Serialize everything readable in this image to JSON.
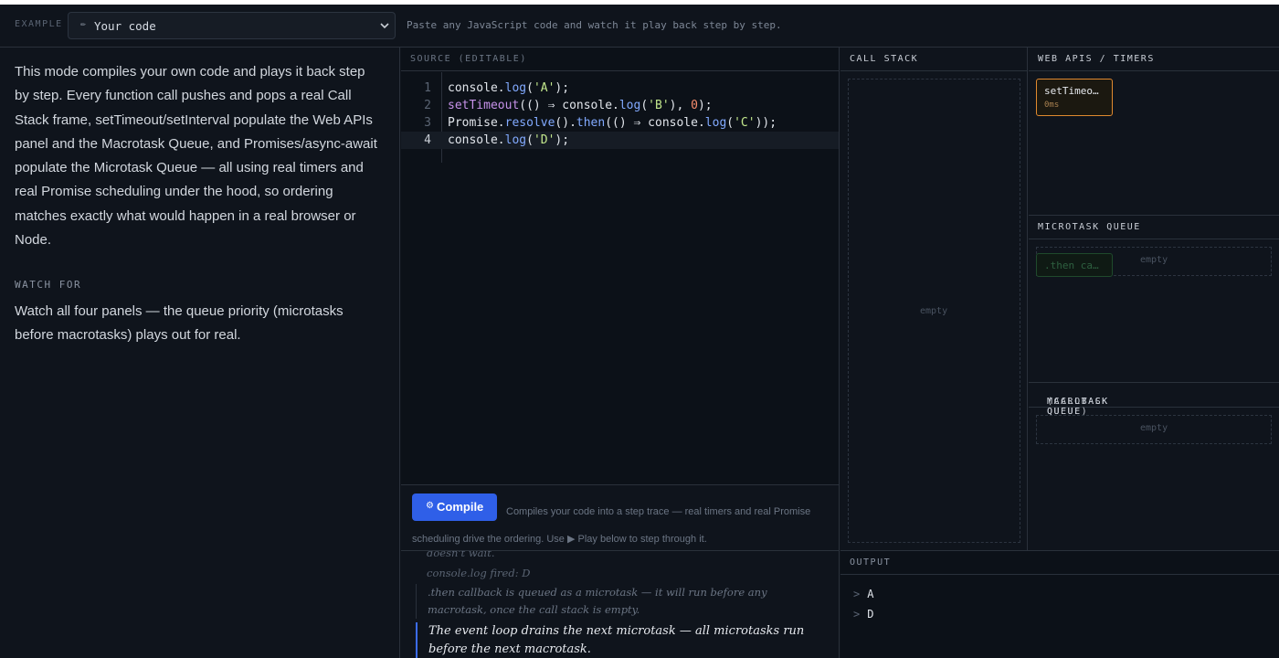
{
  "toolbar": {
    "example_label": "EXAMPLE",
    "select_icon": "pencil-icon",
    "selected_example": "Your code",
    "hint": "Paste any JavaScript code and watch it play back step by step."
  },
  "sidebar": {
    "description": "This mode compiles your own code and plays it back step by step. Every function call pushes and pops a real Call Stack frame, setTimeout/setInterval populate the Web APIs panel and the Macrotask Queue, and Promises/async-await populate the Microtask Queue — all using real timers and real Promise scheduling under the hood, so ordering matches exactly what would happen in a real browser or Node.",
    "watch_heading": "WATCH FOR",
    "watch_text": "Watch all four panels — the queue priority (microtasks before macrotasks) plays out for real."
  },
  "source": {
    "title": "SOURCE (EDITABLE)",
    "active_line": 4,
    "lines": [
      {
        "n": "1",
        "text": "console.log('A');"
      },
      {
        "n": "2",
        "text": "setTimeout(() ⇒ console.log('B'), 0);"
      },
      {
        "n": "3",
        "text": "Promise.resolve().then(() ⇒ console.log('C'));"
      },
      {
        "n": "4",
        "text": "console.log('D');"
      }
    ],
    "compile_button": "Compile",
    "compile_note": "Compiles your code into a step trace — real timers and real Promise scheduling drive the ordering. Use ▶ Play below to step through it."
  },
  "narration": [
    "doesn't wait.",
    "console.log fired: D",
    ".then callback is queued as a microtask — it will run before any macrotask, once the call stack is empty.",
    "The event loop drains the next microtask — all microtasks run before the next macrotask."
  ],
  "call_stack": {
    "title": "CALL STACK",
    "empty_label": "empty"
  },
  "web_apis": {
    "title": "WEB APIS / TIMERS",
    "timers": [
      {
        "name": "setTimeo…",
        "delay": "0ms"
      }
    ]
  },
  "microtask_queue": {
    "title": "MICROTASK QUEUE",
    "ghost_item": ".then ca…",
    "empty_label": "empty"
  },
  "macrotask_queue": {
    "title": "MACROTASK QUEUE",
    "subtitle": "(CALLBACK QUEUE)",
    "empty_label": "empty"
  },
  "output": {
    "title": "OUTPUT",
    "prompt": ">",
    "lines": [
      "A",
      "D"
    ]
  },
  "colors": {
    "accent": "#2f5fe8",
    "timer_border": "#e0892f",
    "microtask_green": "#1f4a2c",
    "background": "#0f141c"
  }
}
